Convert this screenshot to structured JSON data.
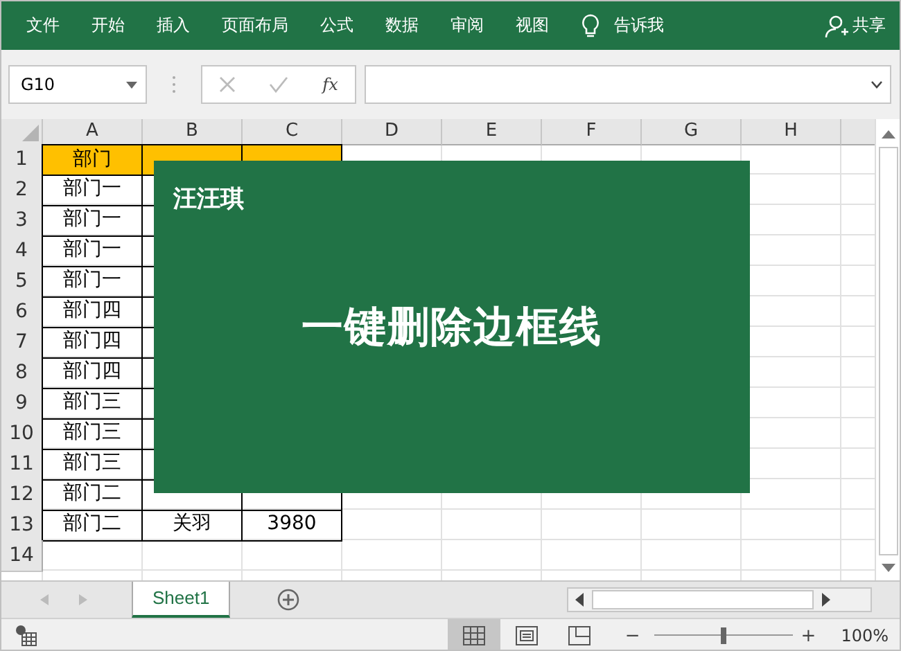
{
  "ribbon": {
    "tabs": [
      {
        "label": "文件",
        "selected": false
      },
      {
        "label": "开始",
        "selected": false
      },
      {
        "label": "插入",
        "selected": false
      },
      {
        "label": "页面布局",
        "selected": false
      },
      {
        "label": "公式",
        "selected": false
      },
      {
        "label": "数据",
        "selected": false
      },
      {
        "label": "审阅",
        "selected": false
      },
      {
        "label": "视图",
        "selected": false
      }
    ],
    "tell_me": "告诉我",
    "share": "共享"
  },
  "formula_bar": {
    "name_box": "G10",
    "fx": "fx"
  },
  "columns": [
    "A",
    "B",
    "C",
    "D",
    "E",
    "F",
    "G",
    "H"
  ],
  "rows": [
    {
      "number": "1",
      "header": true,
      "cells": [
        "部门"
      ]
    },
    {
      "number": "2",
      "header": false,
      "cells": [
        "部门一"
      ]
    },
    {
      "number": "3",
      "header": false,
      "cells": [
        "部门一"
      ]
    },
    {
      "number": "4",
      "header": false,
      "cells": [
        "部门一"
      ]
    },
    {
      "number": "5",
      "header": false,
      "cells": [
        "部门一"
      ]
    },
    {
      "number": "6",
      "header": false,
      "cells": [
        "部门四"
      ]
    },
    {
      "number": "7",
      "header": false,
      "cells": [
        "部门四"
      ]
    },
    {
      "number": "8",
      "header": false,
      "cells": [
        "部门四"
      ]
    },
    {
      "number": "9",
      "header": false,
      "cells": [
        "部门三"
      ]
    },
    {
      "number": "10",
      "header": false,
      "cells": [
        "部门三"
      ]
    },
    {
      "number": "11",
      "header": false,
      "cells": [
        "部门三"
      ]
    },
    {
      "number": "12",
      "header": false,
      "cells": [
        "部门二"
      ]
    },
    {
      "number": "13",
      "header": false,
      "cells": [
        "部门二",
        "关羽",
        "3980"
      ]
    },
    {
      "number": "14",
      "header": false,
      "cells": []
    }
  ],
  "overlay": {
    "author": "汪汪琪",
    "title": "一键删除边框线"
  },
  "sheet_tabs": [
    {
      "label": "Sheet1",
      "selected": true
    }
  ],
  "status_bar": {
    "zoom_minus": "−",
    "zoom_plus": "+",
    "zoom": {
      "level": 0.48
    },
    "zoom_text": "100%"
  }
}
